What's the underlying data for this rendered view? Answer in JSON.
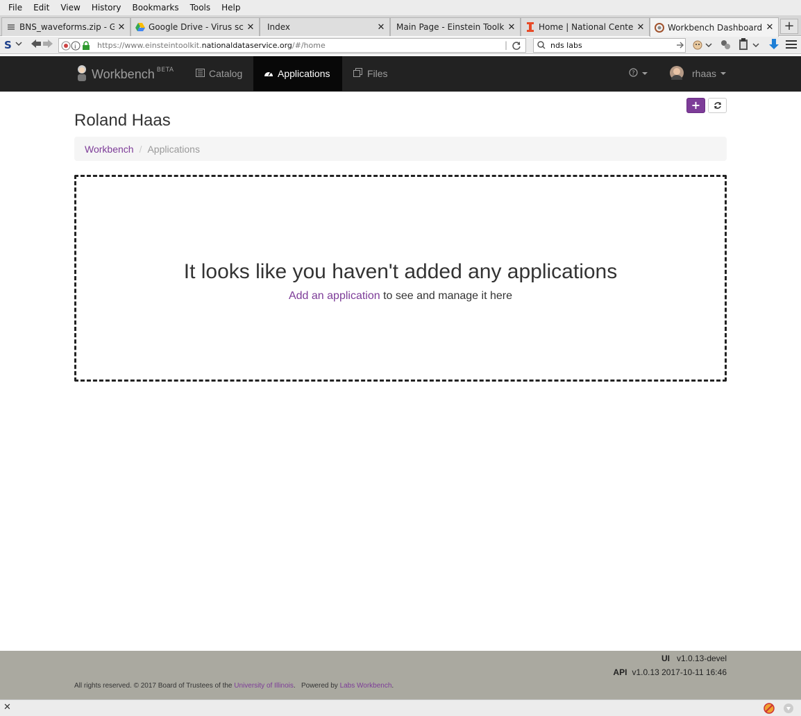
{
  "menubar": {
    "items": [
      "File",
      "Edit",
      "View",
      "History",
      "Bookmarks",
      "Tools",
      "Help"
    ]
  },
  "tabs": [
    {
      "title": "BNS_waveforms.zip - Go...",
      "icon": "archive-icon"
    },
    {
      "title": "Google Drive - Virus sca...",
      "icon": "google-drive-icon"
    },
    {
      "title": "Index",
      "icon": ""
    },
    {
      "title": "Main Page - Einstein Toolki...",
      "icon": ""
    },
    {
      "title": "Home | National Center ...",
      "icon": "illinois-icon"
    },
    {
      "title": "Workbench Dashboard",
      "icon": "workbench-icon"
    }
  ],
  "toolbar": {
    "url_prefix": "https://www.einsteintoolkit.",
    "url_domain": "nationaldataservice.org",
    "url_suffix": "/#/home",
    "search_value": "nds labs"
  },
  "app": {
    "brand_name": "Workbench",
    "brand_badge": "BETA",
    "nav": [
      {
        "label": "Catalog",
        "icon": "book-icon"
      },
      {
        "label": "Applications",
        "icon": "dashboard-icon"
      },
      {
        "label": "Files",
        "icon": "files-icon"
      }
    ],
    "user": "rhaas",
    "help_icon": "?"
  },
  "page": {
    "title": "Roland Haas",
    "breadcrumb": {
      "root": "Workbench",
      "separator": "/",
      "current": "Applications"
    },
    "empty_heading": "It looks like you haven't added any applications",
    "empty_link": "Add an application",
    "empty_text": " to see and manage it here",
    "add_button": "+"
  },
  "footer": {
    "ui_label": "UI",
    "ui_version": "v1.0.13-devel",
    "api_label": "API",
    "api_version": "v1.0.13 2017-10-11 16:46",
    "copyright_prefix": "All rights reserved. © 2017 Board of Trustees of the ",
    "university": "University of Illinois",
    "powered_prefix": ".   Powered by ",
    "powered_link": "Labs Workbench",
    "powered_suffix": "."
  },
  "colors": {
    "accent": "#7d3c98",
    "navbar": "#222222",
    "footer": "#aaa9a0"
  }
}
